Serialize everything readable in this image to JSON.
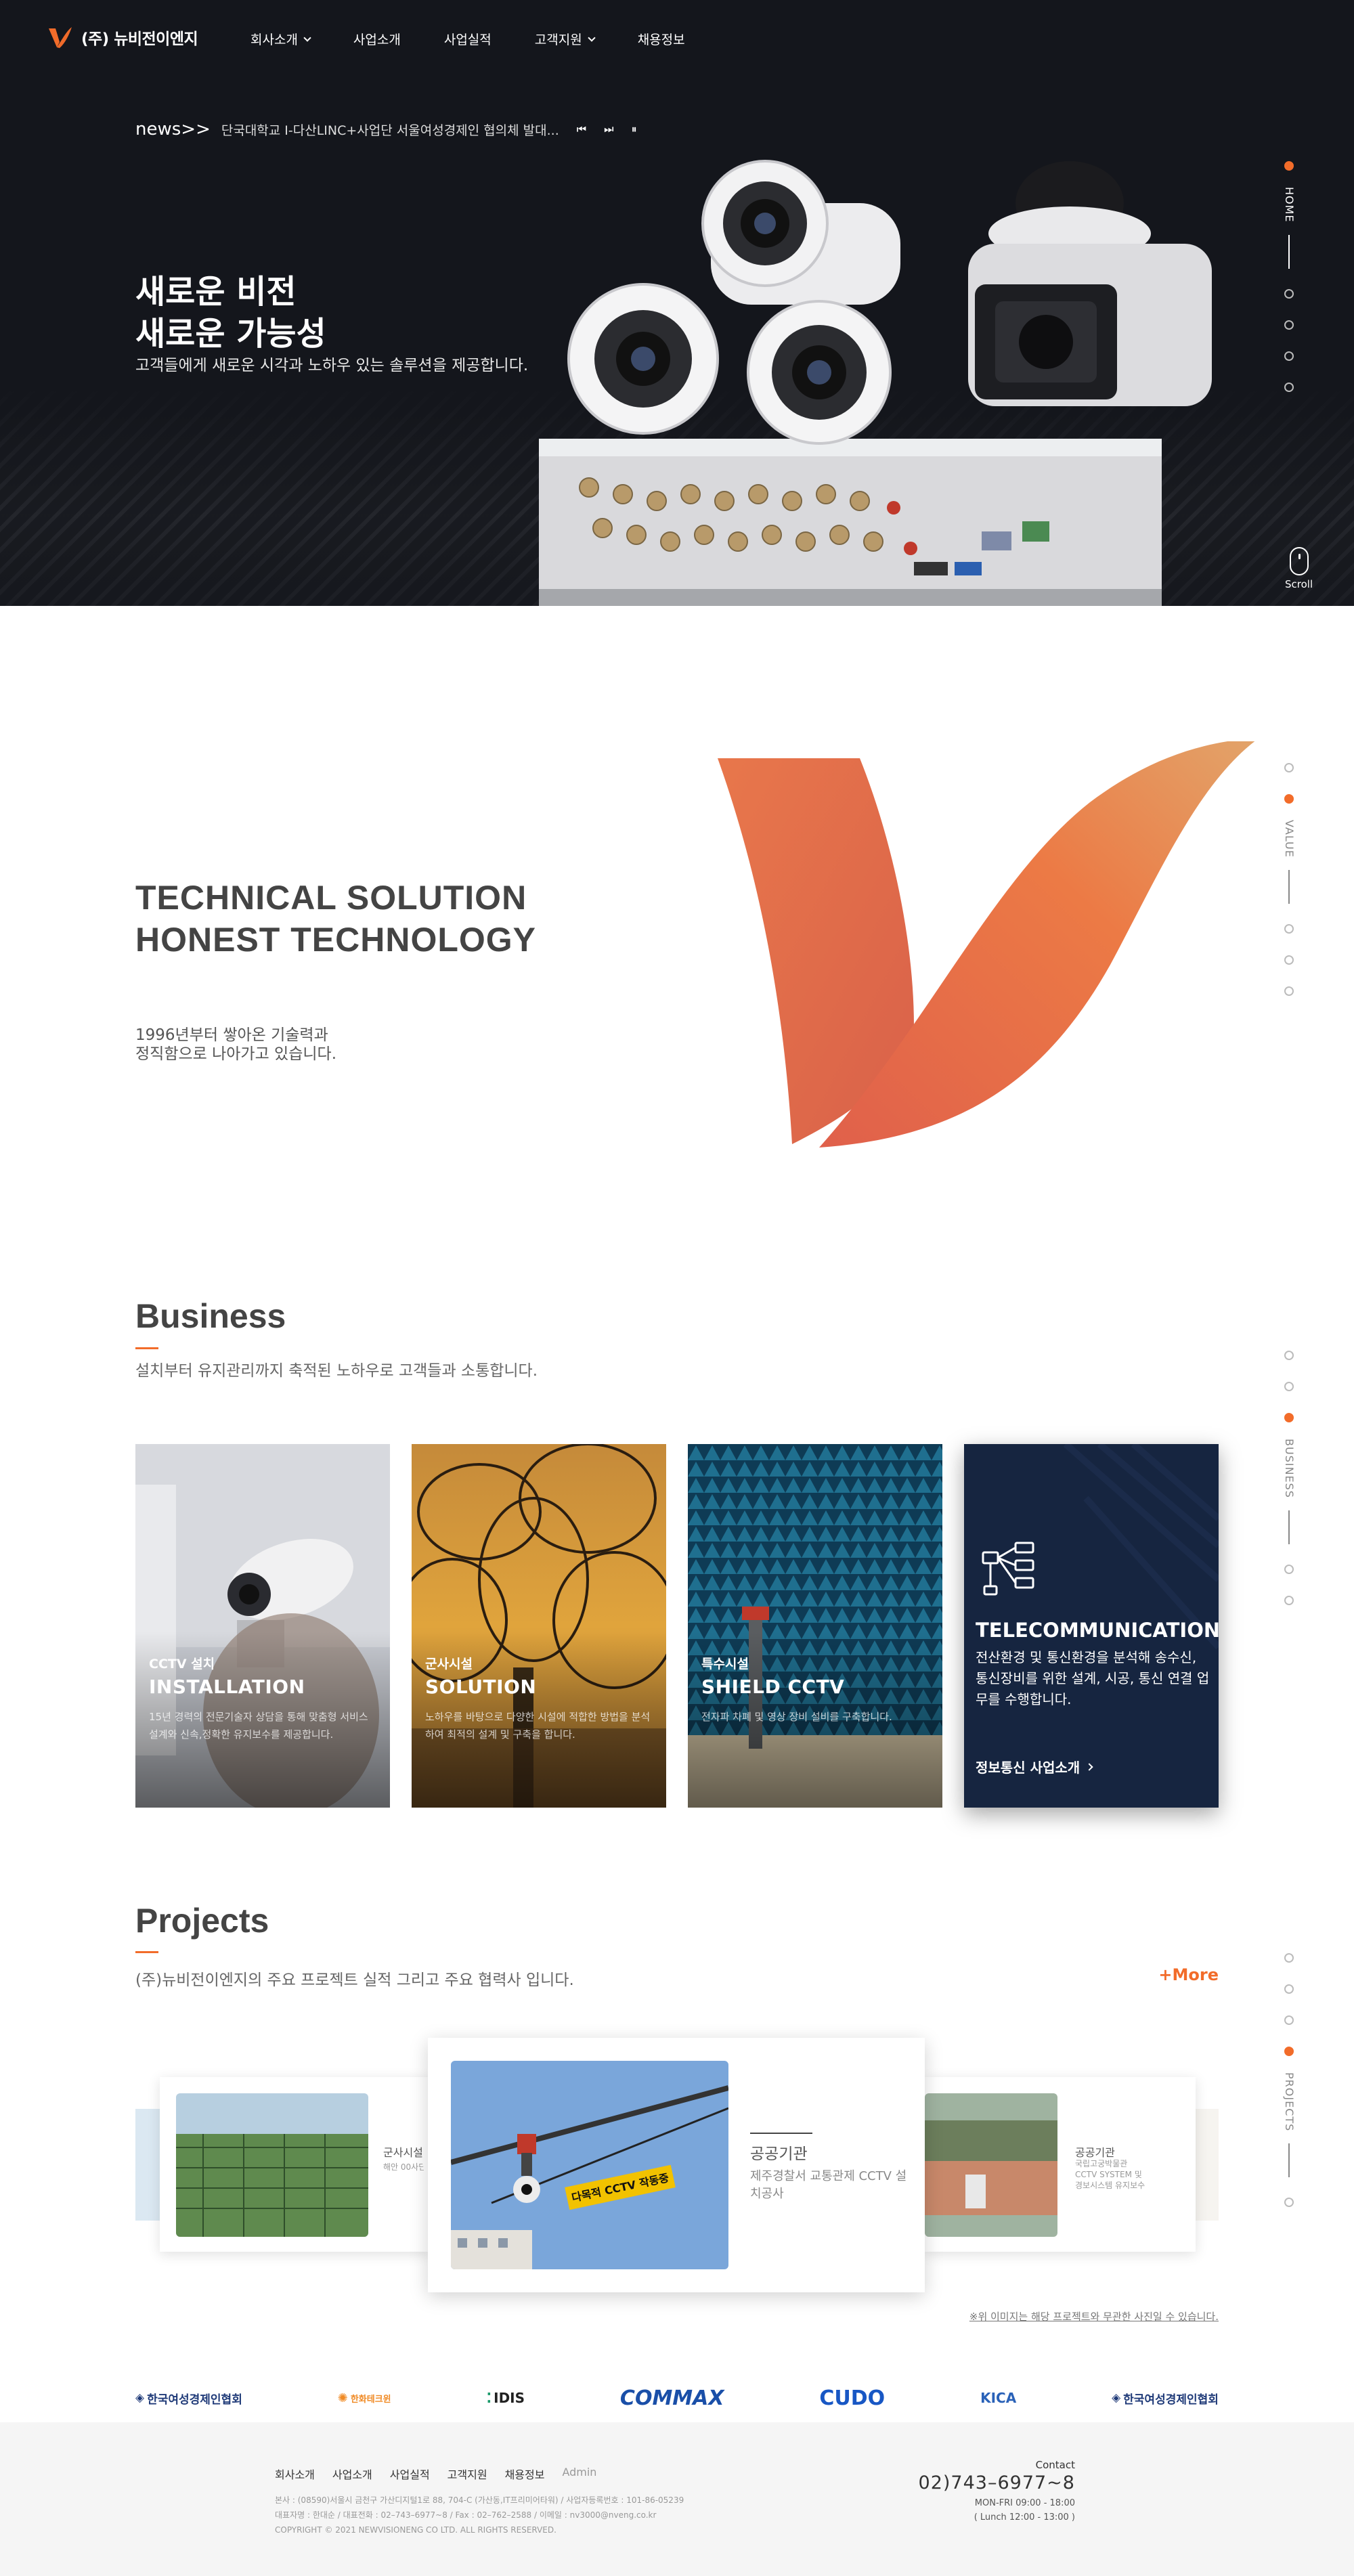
{
  "brand": {
    "logo_text": "(주) 뉴비전이엔지",
    "accent": "#f26c2a"
  },
  "nav": {
    "items": [
      {
        "label": "회사소개",
        "has_dropdown": true
      },
      {
        "label": "사업소개",
        "has_dropdown": false
      },
      {
        "label": "사업실적",
        "has_dropdown": false
      },
      {
        "label": "고객지원",
        "has_dropdown": true
      },
      {
        "label": "채용정보",
        "has_dropdown": false
      }
    ]
  },
  "news": {
    "label": "news>>",
    "text": "단국대학교 I-다산LINC+사업단 서울여성경제인 협의체 발대...",
    "controls": {
      "prev": "⏮",
      "next": "⏭",
      "pause": "⏸"
    }
  },
  "hero": {
    "title_line1": "새로운 비전",
    "title_line2": "새로운 가능성",
    "subtitle": "고객들에게 새로운 시각과 노하우 있는 솔루션을 제공합니다.",
    "scroll_label": "Scroll"
  },
  "side_nav": {
    "home": "HOME",
    "value": "VALUE",
    "business": "BUSINESS",
    "projects": "PROJECTS"
  },
  "value": {
    "title_line1": "TECHNICAL SOLUTION",
    "title_line2": "HONEST TECHNOLOGY",
    "sub_line1": "1996년부터 쌓아온 기술력과",
    "sub_line2": "정직함으로 나아가고 있습니다."
  },
  "business": {
    "title": "Business",
    "subtitle": "설치부터 유지관리까지 축적된 노하우로 고객들과 소통합니다.",
    "cards": [
      {
        "category": "CCTV 설치",
        "name": "INSTALLATION",
        "desc": "15년 경력의 전문기술자 상담을 통해 맞춤형 서비스 설계와 신속,정확한 유지보수를 제공합니다."
      },
      {
        "category": "군사시설",
        "name": "SOLUTION",
        "desc": "노하우를 바탕으로 다양한 시설에 적합한 방법을 분석하여 최적의 설계 및 구축을 합니다."
      },
      {
        "category": "특수시설",
        "name": "SHIELD CCTV",
        "desc": "전자파 차폐 및 영상 장비 설비를 구축합니다."
      }
    ],
    "featured": {
      "name": "TELECOMMUNICATION",
      "desc": "전산환경 및 통신환경을 분석해 송수신, 통신장비를 위한 설계, 시공, 통신 연결 업무를 수행합니다.",
      "link": "정보통신 사업소개"
    }
  },
  "projects": {
    "title": "Projects",
    "subtitle": "(주)뉴비전이엔지의 주요 프로젝트 실적 그리고 주요 협력사 입니다.",
    "more": "+More",
    "slides": [
      {
        "category": "군사시설",
        "desc": "해안 00사단"
      },
      {
        "category": "공공기관",
        "desc": "제주경찰서 교통관제 CCTV 설치공사",
        "sign": "다목적 CCTV 작동중"
      },
      {
        "category": "공공기관",
        "desc": "국립고궁박물관 CCTV SYSTEM 및 경보시스템 유지보수"
      }
    ],
    "note": "※위 이미지는 해당 프로젝트와 무관한 사진일 수 있습니다."
  },
  "partners": [
    {
      "name": "한국여성경제인협회",
      "color": "#1f3a78"
    },
    {
      "name": "한화테크윈",
      "color": "#f08a24"
    },
    {
      "name": "IDIS",
      "color": "#222222"
    },
    {
      "name": "COMMAX",
      "color": "#1a4fa8"
    },
    {
      "name": "CUDO",
      "color": "#1857c4"
    },
    {
      "name": "KICA",
      "color": "#2a62b8"
    },
    {
      "name": "한국여성경제인협회",
      "color": "#1f3a78"
    }
  ],
  "footer": {
    "menu": [
      "회사소개",
      "사업소개",
      "사업실적",
      "고객지원",
      "채용정보"
    ],
    "admin": "Admin",
    "info_line1": "본사 : (08590)서울시 금천구 가산디지털1로 88, 704-C (가산동,IT프리미어타워) / 사업자등록번호 : 101-86-05239",
    "info_line2": "대표자명 : 한대순 / 대표전화 : 02–743–6977~8 / Fax : 02–762–2588 / 이메일 : nv3000@nveng.co.kr",
    "info_line3": "COPYRIGHT © 2021 NEWVISIONENG CO LTD. ALL RIGHTS RESERVED.",
    "contact_label": "Contact",
    "phone": "02)743–6977~8",
    "hours1": "MON-FRI 09:00 - 18:00",
    "hours2": "( Lunch 12:00 - 13:00 )"
  }
}
